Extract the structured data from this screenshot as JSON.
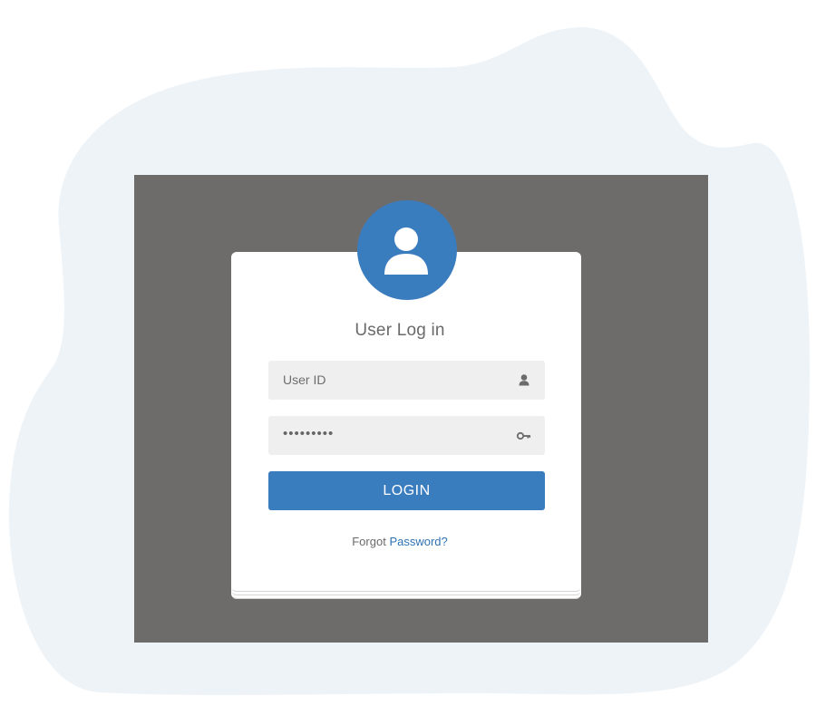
{
  "login": {
    "title": "User Log in",
    "userid_placeholder": "User ID",
    "password_value": "•••••••••",
    "login_label": "LOGIN",
    "forgot_prefix": "Forgot",
    "forgot_link": "Password?"
  },
  "colors": {
    "accent": "#3a7dbf",
    "backdrop": "#6e6c6b",
    "blob": "#eef3f8",
    "field_bg": "#efefef"
  },
  "icons": {
    "avatar": "user-icon",
    "userid": "user-icon",
    "password": "key-icon"
  }
}
